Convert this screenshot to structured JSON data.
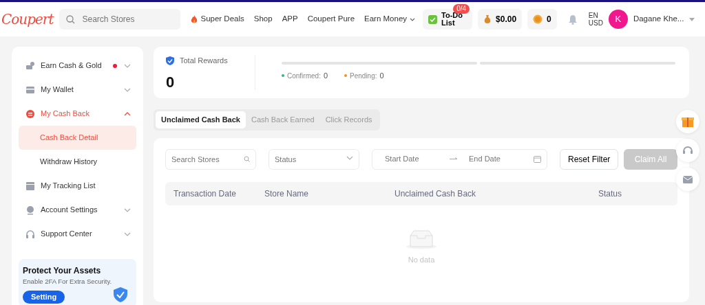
{
  "header": {
    "logo": "Coupert",
    "search": {
      "placeholder": "Search Stores"
    },
    "nav": [
      {
        "label": "Super Deals",
        "hot": true,
        "dropdown": false
      },
      {
        "label": "Shop",
        "hot": false,
        "dropdown": false
      },
      {
        "label": "APP",
        "hot": false,
        "dropdown": false
      },
      {
        "label": "Coupert Pure",
        "hot": false,
        "dropdown": false
      },
      {
        "label": "Earn Money",
        "hot": false,
        "dropdown": true
      }
    ],
    "todo": {
      "label": "To-Do List",
      "badge": "0/4"
    },
    "balance": "$0.00",
    "gold": "0",
    "language": "EN",
    "currency": "USD",
    "avatar": "K",
    "user": "Dagane Khe..."
  },
  "sidebar": {
    "items": [
      {
        "label": "Earn Cash & Gold",
        "dot": true,
        "selected": false,
        "expanded": false
      },
      {
        "label": "My Wallet",
        "dot": false,
        "selected": false,
        "expanded": false
      },
      {
        "label": "My Cash Back",
        "dot": false,
        "selected": true,
        "expanded": true,
        "children": [
          {
            "label": "Cash Back Detail",
            "selected": true
          },
          {
            "label": "Withdraw History",
            "selected": false
          }
        ]
      },
      {
        "label": "My Tracking List",
        "dot": false,
        "selected": false
      },
      {
        "label": "Account Settings",
        "dot": false,
        "selected": false,
        "expanded": false
      },
      {
        "label": "Support Center",
        "dot": false,
        "selected": false,
        "expanded": false
      }
    ],
    "promo": {
      "title": "Protect Your Assets",
      "text": "Enable 2FA For Extra Security.",
      "button": "Setting"
    }
  },
  "rewards": {
    "title": "Total Rewards",
    "value": "0",
    "confirmed": {
      "label": "Confirmed:",
      "value": "0"
    },
    "pending": {
      "label": "Pending:",
      "value": "0"
    }
  },
  "tabs": [
    {
      "label": "Unclaimed Cash Back",
      "selected": true
    },
    {
      "label": "Cash Back Earned",
      "selected": false
    },
    {
      "label": "Click Records",
      "selected": false
    }
  ],
  "filters": {
    "search": {
      "placeholder": "Search Stores"
    },
    "status": {
      "placeholder": "Status"
    },
    "start_date": {
      "placeholder": "Start Date"
    },
    "end_date": {
      "placeholder": "End Date"
    },
    "reset": "Reset Filter",
    "claim": {
      "label": "Claim All",
      "disabled": true
    }
  },
  "table": {
    "columns": [
      "Transaction Date",
      "Store Name",
      "Unclaimed Cash Back",
      "Status"
    ],
    "empty": "No data"
  }
}
